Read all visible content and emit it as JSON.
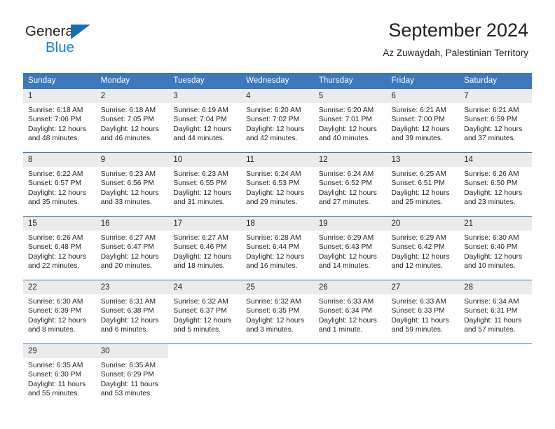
{
  "brand": {
    "name_top": "General",
    "name_bottom": "Blue",
    "accent_color": "#146eb4",
    "blue_text_color": "#1c7fd6"
  },
  "header": {
    "title": "September 2024",
    "subtitle": "Az Zuwaydah, Palestinian Territory"
  },
  "calendar": {
    "header_bg": "#3c78bc",
    "daynum_bg": "#ebebeb",
    "weekday_headers": [
      "Sunday",
      "Monday",
      "Tuesday",
      "Wednesday",
      "Thursday",
      "Friday",
      "Saturday"
    ],
    "weeks": [
      [
        {
          "day": "1",
          "sunrise": "Sunrise: 6:18 AM",
          "sunset": "Sunset: 7:06 PM",
          "daylight_line1": "Daylight: 12 hours",
          "daylight_line2": "and 48 minutes."
        },
        {
          "day": "2",
          "sunrise": "Sunrise: 6:18 AM",
          "sunset": "Sunset: 7:05 PM",
          "daylight_line1": "Daylight: 12 hours",
          "daylight_line2": "and 46 minutes."
        },
        {
          "day": "3",
          "sunrise": "Sunrise: 6:19 AM",
          "sunset": "Sunset: 7:04 PM",
          "daylight_line1": "Daylight: 12 hours",
          "daylight_line2": "and 44 minutes."
        },
        {
          "day": "4",
          "sunrise": "Sunrise: 6:20 AM",
          "sunset": "Sunset: 7:02 PM",
          "daylight_line1": "Daylight: 12 hours",
          "daylight_line2": "and 42 minutes."
        },
        {
          "day": "5",
          "sunrise": "Sunrise: 6:20 AM",
          "sunset": "Sunset: 7:01 PM",
          "daylight_line1": "Daylight: 12 hours",
          "daylight_line2": "and 40 minutes."
        },
        {
          "day": "6",
          "sunrise": "Sunrise: 6:21 AM",
          "sunset": "Sunset: 7:00 PM",
          "daylight_line1": "Daylight: 12 hours",
          "daylight_line2": "and 39 minutes."
        },
        {
          "day": "7",
          "sunrise": "Sunrise: 6:21 AM",
          "sunset": "Sunset: 6:59 PM",
          "daylight_line1": "Daylight: 12 hours",
          "daylight_line2": "and 37 minutes."
        }
      ],
      [
        {
          "day": "8",
          "sunrise": "Sunrise: 6:22 AM",
          "sunset": "Sunset: 6:57 PM",
          "daylight_line1": "Daylight: 12 hours",
          "daylight_line2": "and 35 minutes."
        },
        {
          "day": "9",
          "sunrise": "Sunrise: 6:23 AM",
          "sunset": "Sunset: 6:56 PM",
          "daylight_line1": "Daylight: 12 hours",
          "daylight_line2": "and 33 minutes."
        },
        {
          "day": "10",
          "sunrise": "Sunrise: 6:23 AM",
          "sunset": "Sunset: 6:55 PM",
          "daylight_line1": "Daylight: 12 hours",
          "daylight_line2": "and 31 minutes."
        },
        {
          "day": "11",
          "sunrise": "Sunrise: 6:24 AM",
          "sunset": "Sunset: 6:53 PM",
          "daylight_line1": "Daylight: 12 hours",
          "daylight_line2": "and 29 minutes."
        },
        {
          "day": "12",
          "sunrise": "Sunrise: 6:24 AM",
          "sunset": "Sunset: 6:52 PM",
          "daylight_line1": "Daylight: 12 hours",
          "daylight_line2": "and 27 minutes."
        },
        {
          "day": "13",
          "sunrise": "Sunrise: 6:25 AM",
          "sunset": "Sunset: 6:51 PM",
          "daylight_line1": "Daylight: 12 hours",
          "daylight_line2": "and 25 minutes."
        },
        {
          "day": "14",
          "sunrise": "Sunrise: 6:26 AM",
          "sunset": "Sunset: 6:50 PM",
          "daylight_line1": "Daylight: 12 hours",
          "daylight_line2": "and 23 minutes."
        }
      ],
      [
        {
          "day": "15",
          "sunrise": "Sunrise: 6:26 AM",
          "sunset": "Sunset: 6:48 PM",
          "daylight_line1": "Daylight: 12 hours",
          "daylight_line2": "and 22 minutes."
        },
        {
          "day": "16",
          "sunrise": "Sunrise: 6:27 AM",
          "sunset": "Sunset: 6:47 PM",
          "daylight_line1": "Daylight: 12 hours",
          "daylight_line2": "and 20 minutes."
        },
        {
          "day": "17",
          "sunrise": "Sunrise: 6:27 AM",
          "sunset": "Sunset: 6:46 PM",
          "daylight_line1": "Daylight: 12 hours",
          "daylight_line2": "and 18 minutes."
        },
        {
          "day": "18",
          "sunrise": "Sunrise: 6:28 AM",
          "sunset": "Sunset: 6:44 PM",
          "daylight_line1": "Daylight: 12 hours",
          "daylight_line2": "and 16 minutes."
        },
        {
          "day": "19",
          "sunrise": "Sunrise: 6:29 AM",
          "sunset": "Sunset: 6:43 PM",
          "daylight_line1": "Daylight: 12 hours",
          "daylight_line2": "and 14 minutes."
        },
        {
          "day": "20",
          "sunrise": "Sunrise: 6:29 AM",
          "sunset": "Sunset: 6:42 PM",
          "daylight_line1": "Daylight: 12 hours",
          "daylight_line2": "and 12 minutes."
        },
        {
          "day": "21",
          "sunrise": "Sunrise: 6:30 AM",
          "sunset": "Sunset: 6:40 PM",
          "daylight_line1": "Daylight: 12 hours",
          "daylight_line2": "and 10 minutes."
        }
      ],
      [
        {
          "day": "22",
          "sunrise": "Sunrise: 6:30 AM",
          "sunset": "Sunset: 6:39 PM",
          "daylight_line1": "Daylight: 12 hours",
          "daylight_line2": "and 8 minutes."
        },
        {
          "day": "23",
          "sunrise": "Sunrise: 6:31 AM",
          "sunset": "Sunset: 6:38 PM",
          "daylight_line1": "Daylight: 12 hours",
          "daylight_line2": "and 6 minutes."
        },
        {
          "day": "24",
          "sunrise": "Sunrise: 6:32 AM",
          "sunset": "Sunset: 6:37 PM",
          "daylight_line1": "Daylight: 12 hours",
          "daylight_line2": "and 5 minutes."
        },
        {
          "day": "25",
          "sunrise": "Sunrise: 6:32 AM",
          "sunset": "Sunset: 6:35 PM",
          "daylight_line1": "Daylight: 12 hours",
          "daylight_line2": "and 3 minutes."
        },
        {
          "day": "26",
          "sunrise": "Sunrise: 6:33 AM",
          "sunset": "Sunset: 6:34 PM",
          "daylight_line1": "Daylight: 12 hours",
          "daylight_line2": "and 1 minute."
        },
        {
          "day": "27",
          "sunrise": "Sunrise: 6:33 AM",
          "sunset": "Sunset: 6:33 PM",
          "daylight_line1": "Daylight: 11 hours",
          "daylight_line2": "and 59 minutes."
        },
        {
          "day": "28",
          "sunrise": "Sunrise: 6:34 AM",
          "sunset": "Sunset: 6:31 PM",
          "daylight_line1": "Daylight: 11 hours",
          "daylight_line2": "and 57 minutes."
        }
      ],
      [
        {
          "day": "29",
          "sunrise": "Sunrise: 6:35 AM",
          "sunset": "Sunset: 6:30 PM",
          "daylight_line1": "Daylight: 11 hours",
          "daylight_line2": "and 55 minutes."
        },
        {
          "day": "30",
          "sunrise": "Sunrise: 6:35 AM",
          "sunset": "Sunset: 6:29 PM",
          "daylight_line1": "Daylight: 11 hours",
          "daylight_line2": "and 53 minutes."
        },
        {
          "day": "",
          "sunrise": "",
          "sunset": "",
          "daylight_line1": "",
          "daylight_line2": ""
        },
        {
          "day": "",
          "sunrise": "",
          "sunset": "",
          "daylight_line1": "",
          "daylight_line2": ""
        },
        {
          "day": "",
          "sunrise": "",
          "sunset": "",
          "daylight_line1": "",
          "daylight_line2": ""
        },
        {
          "day": "",
          "sunrise": "",
          "sunset": "",
          "daylight_line1": "",
          "daylight_line2": ""
        },
        {
          "day": "",
          "sunrise": "",
          "sunset": "",
          "daylight_line1": "",
          "daylight_line2": ""
        }
      ]
    ]
  }
}
